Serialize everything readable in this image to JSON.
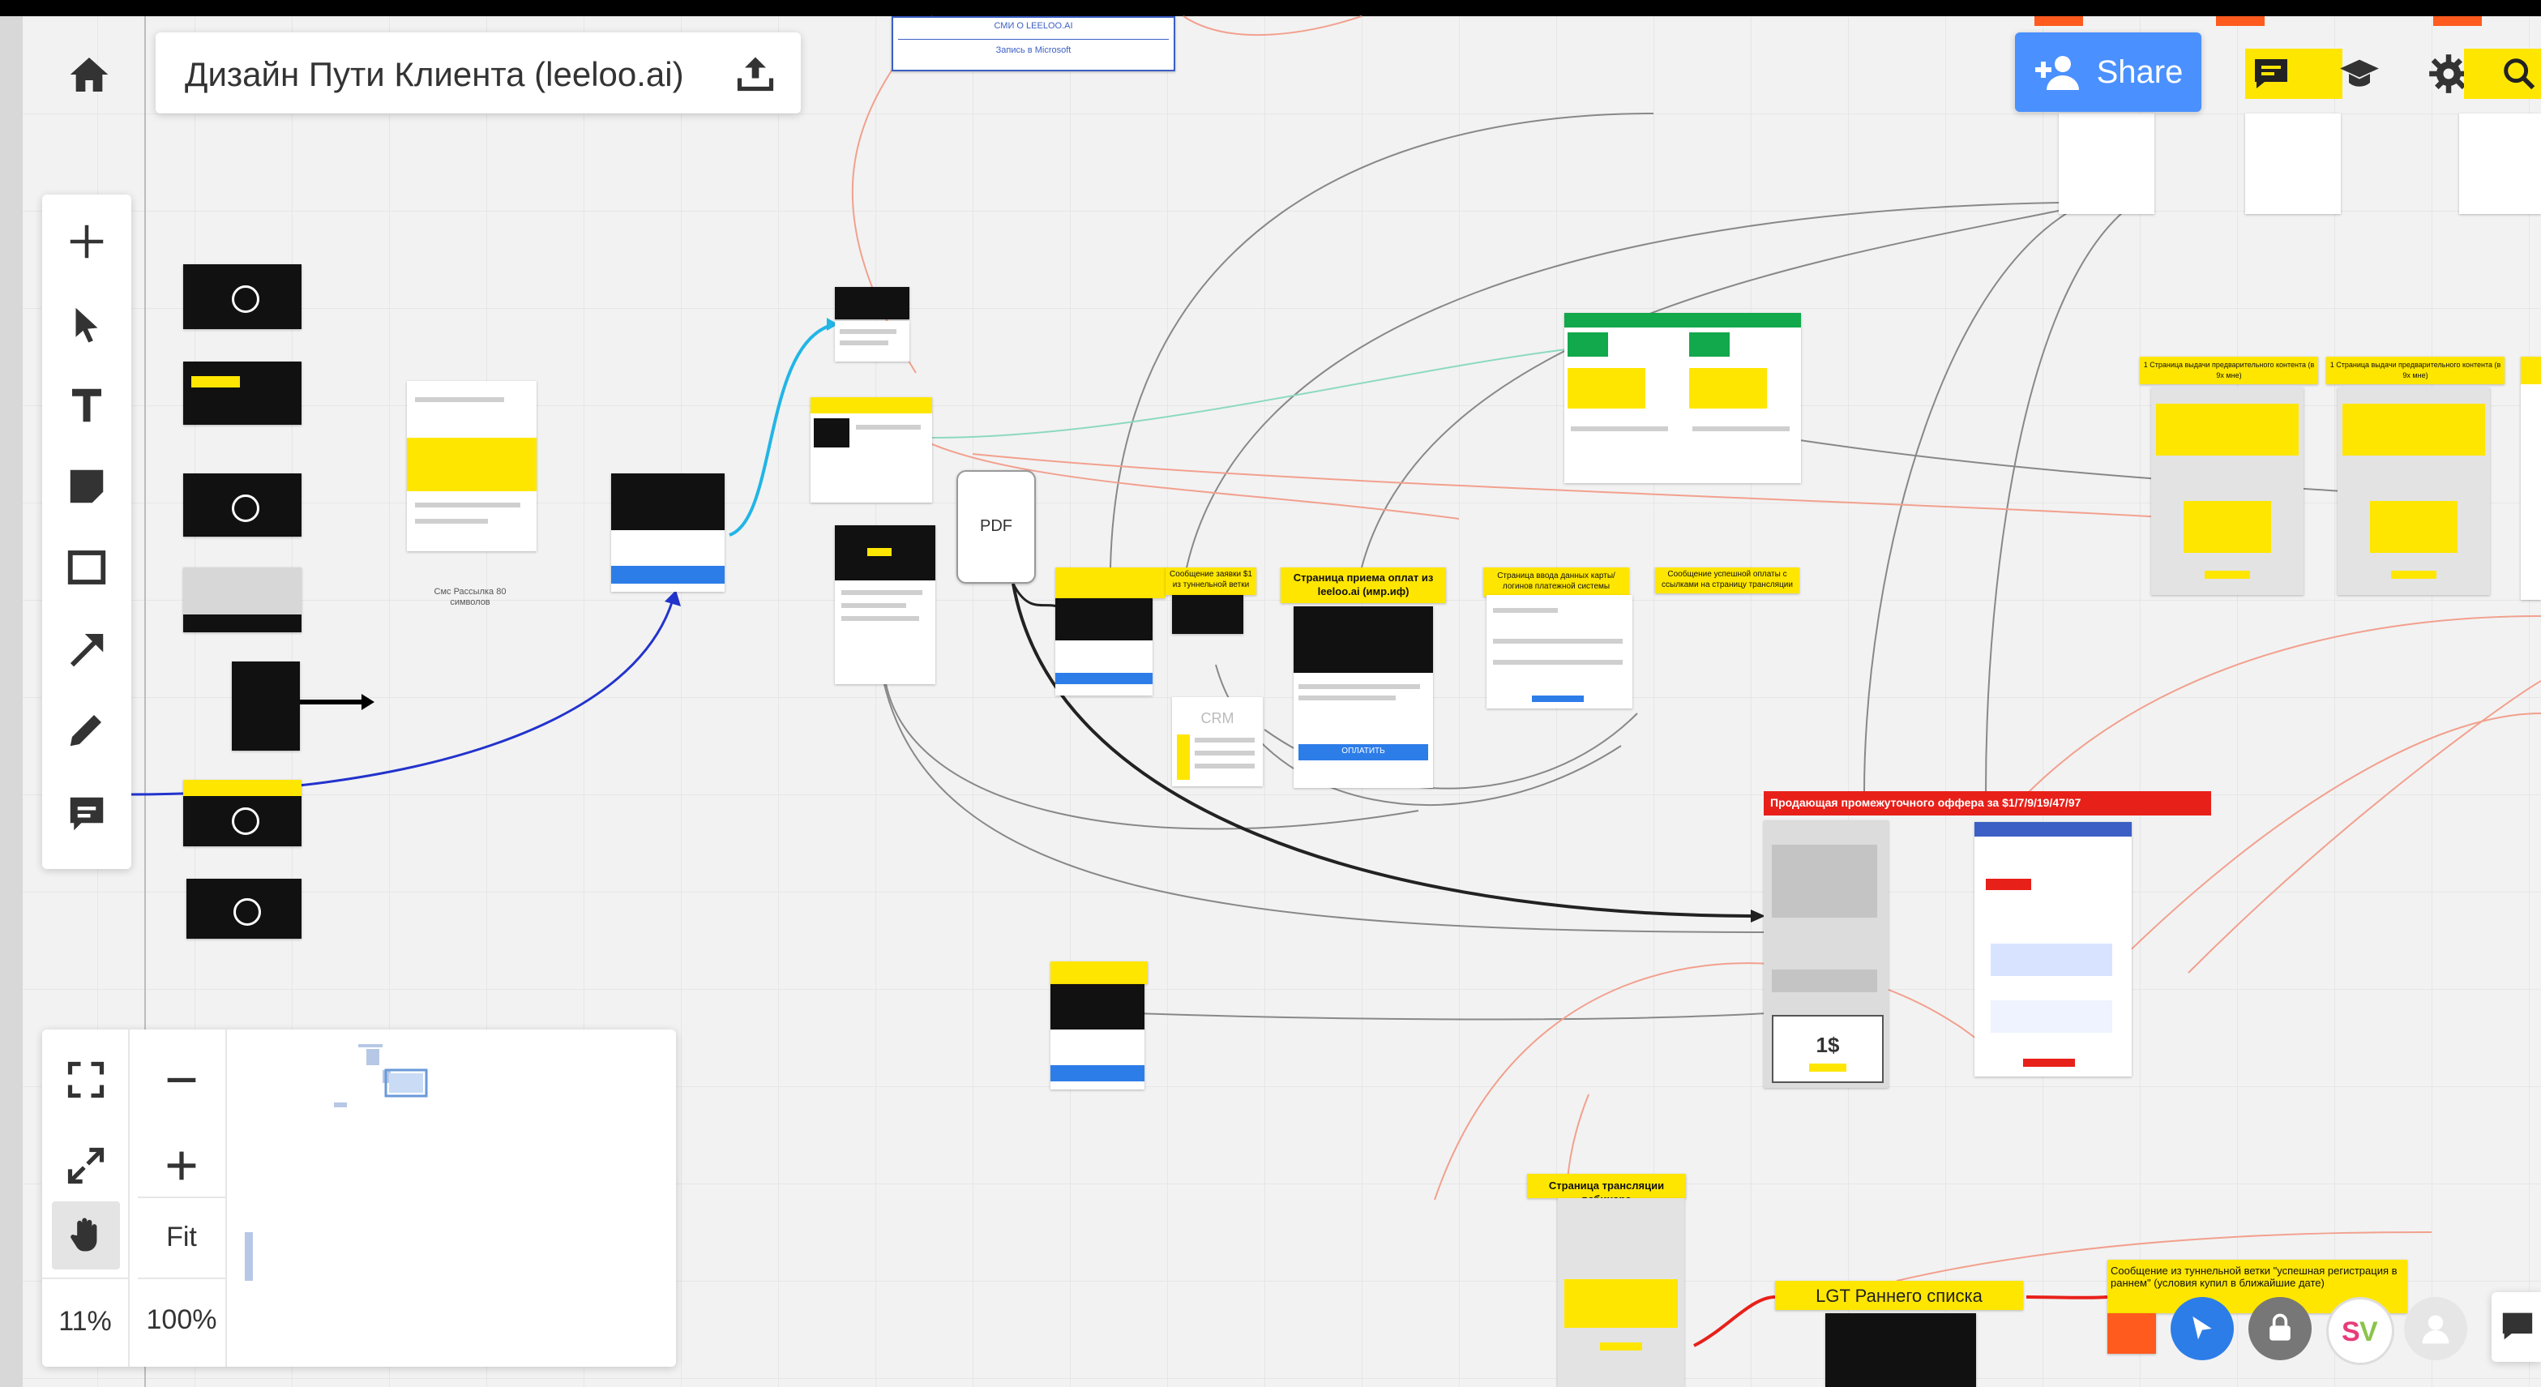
{
  "board": {
    "title": "Дизайн Пути Клиента (leeloo.ai)",
    "top_snippet_1": "СМИ О LEELOO.AI",
    "top_snippet_2": "Запись в Microsoft"
  },
  "header": {
    "share_label": "Share",
    "share_color": "#4a90ff"
  },
  "toolbar": {
    "tools": [
      "add-icon",
      "select-cursor-icon",
      "text-icon",
      "sticky-note-icon",
      "rectangle-icon",
      "arrow-icon",
      "pen-icon",
      "comment-icon"
    ]
  },
  "navigation": {
    "zoom_level": "11%",
    "fit_label": "Fit",
    "full_zoom_label": "100%"
  },
  "canvas": {
    "pdf_label": "PDF",
    "payment_page_title": "Страница приема оплат из leeloo.ai (имр.иф)",
    "payment_button": "ОПЛАТИТЬ",
    "offer_banner": "Продающая промежуточного оффера за $1/7/9/19/47/97",
    "price_label": "1$",
    "webinar_page_title": "Страница трансляции вебинара",
    "lgt_label": "LGT Раннего списка",
    "message_label": "Сообщение из туннельной ветки \"успешная регистрация в раннем\" (условия купил в ближайшие дате)",
    "success_msg_label": "Сообщение успешной оплаты с ссылками на страницу трансляции",
    "data_entry_label": "Страница ввода данных карты/логинов платежной системы",
    "reminder_label": "Сообщение заявки $1 из туннельной ветки",
    "content_label_1": "1 Страница выдачи предварительного контента (в 9x мне)",
    "content_label_2": "1 Страница выдачи предварительного контента (в 9x мне)",
    "crm_label": "CRM",
    "mailing_label": "Смс Рассылка 80 символов"
  },
  "accent_colors": {
    "yellow": "#ffe600",
    "red": "#e8201a",
    "green": "#12a84c",
    "blue_line": "#2233cc",
    "cyan_line": "#22b5e6"
  }
}
